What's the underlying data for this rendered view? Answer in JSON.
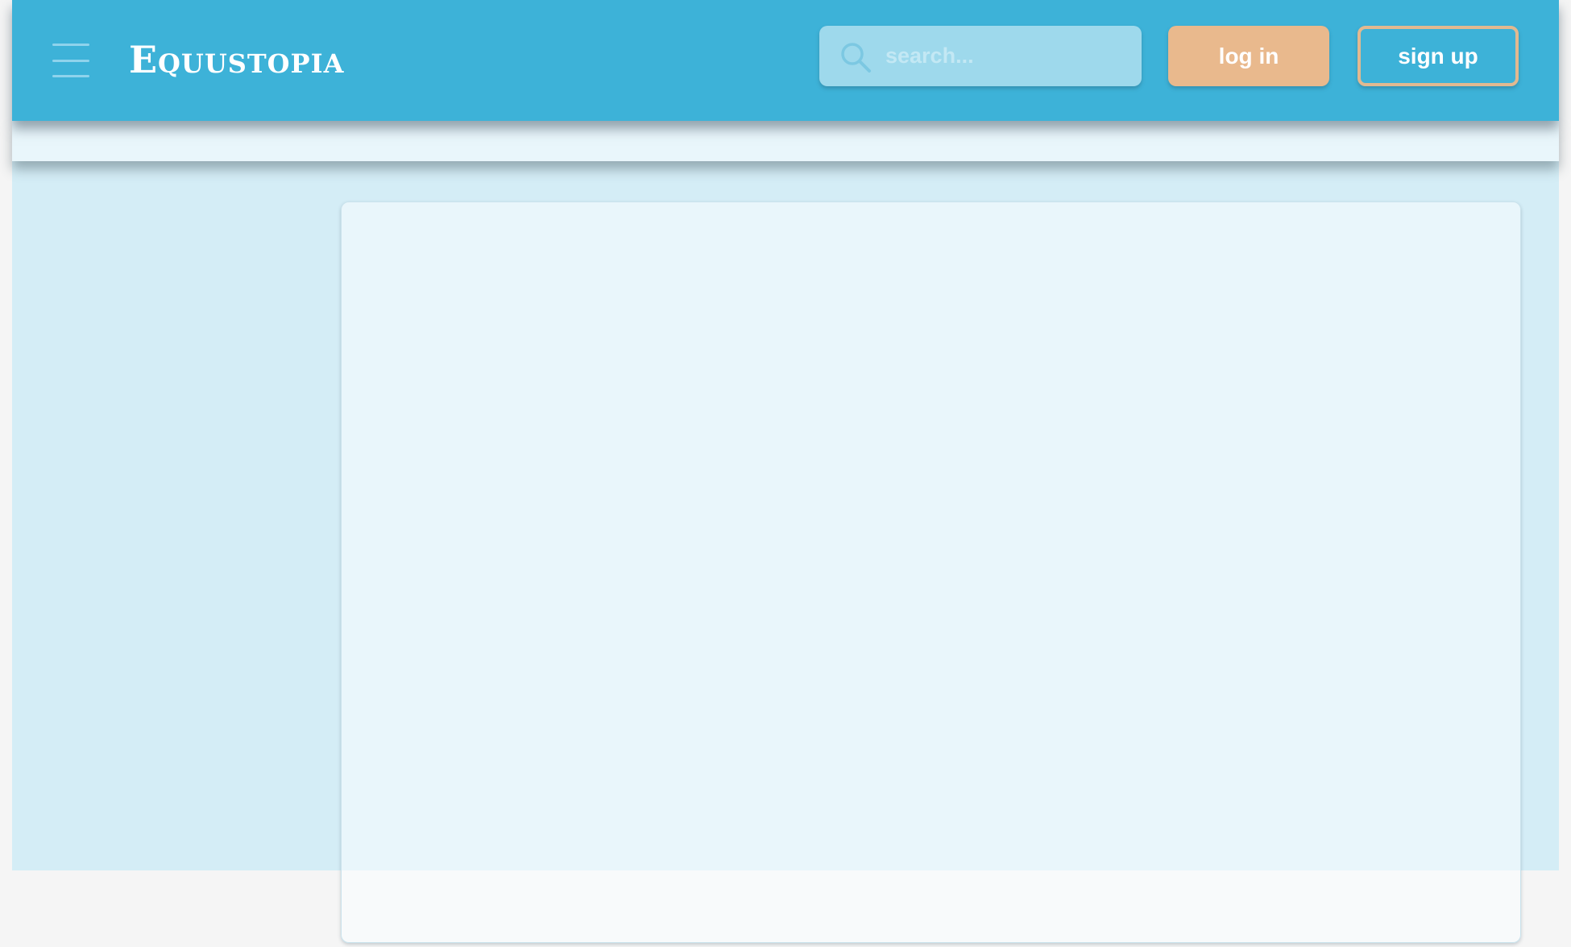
{
  "header": {
    "brand": "Equustopia",
    "menu_icon": "hamburger-menu-icon",
    "search": {
      "placeholder": "search...",
      "icon": "search-icon"
    },
    "login_label": "log in",
    "signup_label": "sign up"
  },
  "colors": {
    "header_bg": "#3db2d8",
    "page_bg": "#d4edf6",
    "login_bg": "#e9b98d",
    "signup_border": "#e2b990"
  }
}
